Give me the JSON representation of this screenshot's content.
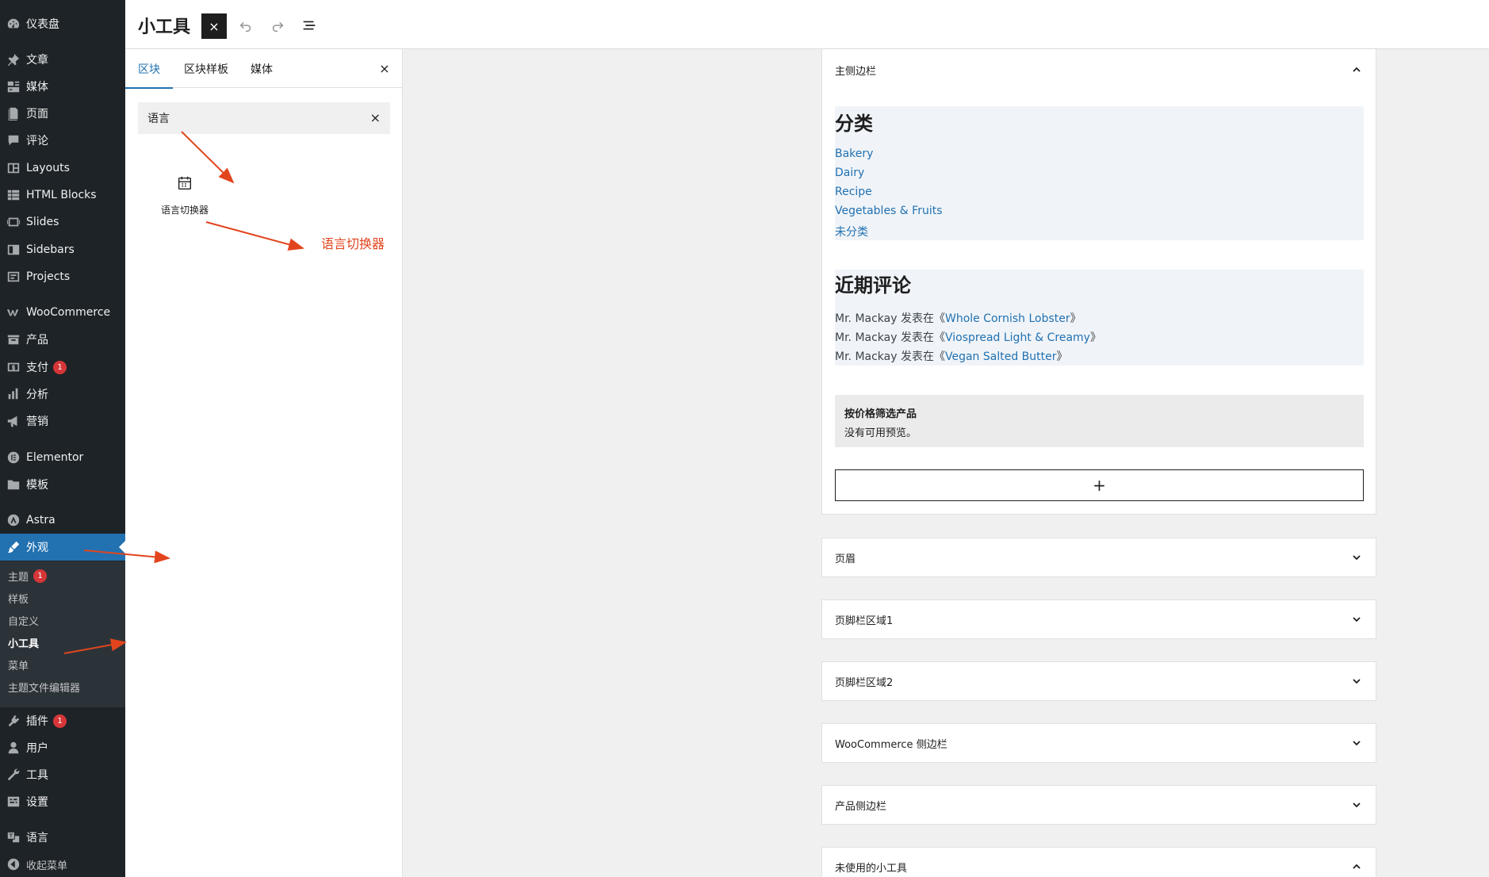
{
  "admin_menu": {
    "items": [
      {
        "label": "仪表盘",
        "icon": "dashboard-icon"
      },
      {
        "label": "文章",
        "icon": "pin-icon"
      },
      {
        "label": "媒体",
        "icon": "media-icon"
      },
      {
        "label": "页面",
        "icon": "page-icon"
      },
      {
        "label": "评论",
        "icon": "comment-icon"
      },
      {
        "label": "Layouts",
        "icon": "layout-icon"
      },
      {
        "label": "HTML Blocks",
        "icon": "grid-icon"
      },
      {
        "label": "Slides",
        "icon": "slides-icon"
      },
      {
        "label": "Sidebars",
        "icon": "sidebar-icon"
      },
      {
        "label": "Projects",
        "icon": "portfolio-icon"
      },
      {
        "label": "WooCommerce",
        "icon": "woo-icon"
      },
      {
        "label": "产品",
        "icon": "archive-icon"
      },
      {
        "label": "支付",
        "icon": "payment-icon",
        "badge": "1"
      },
      {
        "label": "分析",
        "icon": "chart-icon"
      },
      {
        "label": "营销",
        "icon": "megaphone-icon"
      },
      {
        "label": "Elementor",
        "icon": "elementor-icon"
      },
      {
        "label": "模板",
        "icon": "folder-icon"
      },
      {
        "label": "Astra",
        "icon": "astra-icon"
      },
      {
        "label": "外观",
        "icon": "brush-icon"
      },
      {
        "label": "插件",
        "icon": "plugin-icon",
        "badge": "1"
      },
      {
        "label": "用户",
        "icon": "user-icon"
      },
      {
        "label": "工具",
        "icon": "wrench-icon"
      },
      {
        "label": "设置",
        "icon": "settings-icon"
      },
      {
        "label": "语言",
        "icon": "translate-icon"
      },
      {
        "label": "收起菜单",
        "icon": "collapse-icon"
      }
    ],
    "submenu": [
      {
        "label": "主题",
        "badge": "1"
      },
      {
        "label": "样板"
      },
      {
        "label": "自定义"
      },
      {
        "label": "小工具"
      },
      {
        "label": "菜单"
      },
      {
        "label": "主题文件编辑器"
      }
    ]
  },
  "header": {
    "title": "小工具",
    "close_icon": "×"
  },
  "inserter": {
    "tabs": [
      "区块",
      "区块样板",
      "媒体"
    ],
    "close_icon": "×",
    "search_value": "语言",
    "clear_icon": "×",
    "result_label": "语言切换器",
    "annotation": "语言切换器"
  },
  "widget_areas": {
    "main": {
      "title": "主侧边栏",
      "categories_title": "分类",
      "categories": [
        "Bakery",
        "Dairy",
        "Recipe",
        "Vegetables & Fruits",
        "未分类"
      ],
      "comments_title": "近期评论",
      "comments": [
        {
          "author": "Mr. Mackay",
          "sep": " 发表在《",
          "post": "Whole Cornish Lobster",
          "end": "》"
        },
        {
          "author": "Mr. Mackay",
          "sep": " 发表在《",
          "post": "Viospread Light & Creamy",
          "end": "》"
        },
        {
          "author": "Mr. Mackay",
          "sep": " 发表在《",
          "post": "Vegan Salted Butter",
          "end": "》"
        }
      ],
      "price_filter_title": "按价格筛选产品",
      "price_filter_note": "没有可用预览。",
      "add_symbol": "+"
    },
    "collapsed": [
      "页眉",
      "页脚栏区域1",
      "页脚栏区域2",
      "WooCommerce 侧边栏",
      "产品侧边栏",
      "未使用的小工具"
    ]
  },
  "colors": {
    "admin_bg": "#1d2327",
    "accent": "#2271b1",
    "badge": "#d63638",
    "annotation": "#e2451e"
  }
}
